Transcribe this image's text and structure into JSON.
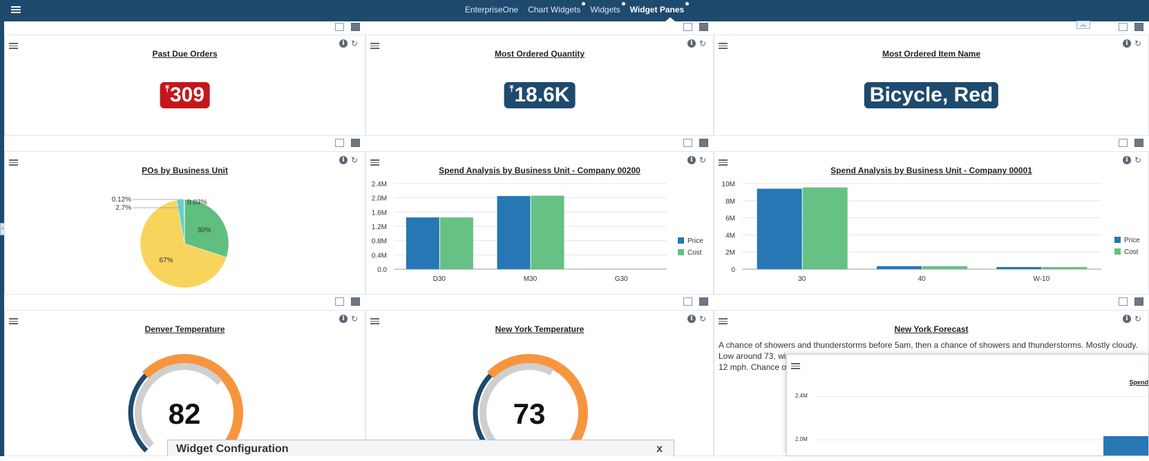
{
  "nav": {
    "items": [
      {
        "label": "EnterpriseOne",
        "active": false,
        "dot": false
      },
      {
        "label": "Chart Widgets",
        "active": false,
        "dot": true
      },
      {
        "label": "Widgets",
        "active": false,
        "dot": true
      },
      {
        "label": "Widget Panes",
        "active": true,
        "dot": true
      }
    ]
  },
  "panes": {
    "past_due": {
      "title": "Past Due Orders",
      "value": "309",
      "arrow": "⤒",
      "color": "#c4161c"
    },
    "most_qty": {
      "title": "Most Ordered Quantity",
      "value": "18.6K",
      "arrow": "⤒",
      "color": "#1e4a6e"
    },
    "most_item": {
      "title": "Most Ordered Item Name",
      "value": "Bicycle, Red",
      "color": "#1e4a6e"
    },
    "pos_bu": {
      "title": "POs by Business Unit"
    },
    "spend_200": {
      "title": "Spend Analysis by Business Unit - Company 00200"
    },
    "spend_001": {
      "title": "Spend Analysis by Business Unit - Company 00001"
    },
    "denver": {
      "title": "Denver Temperature",
      "value": "82"
    },
    "newyork": {
      "title": "New York Temperature",
      "value": "73"
    },
    "forecast": {
      "title": "New York Forecast",
      "line1": "A chance of showers and thunderstorms before 5am, then a chance of showers and thunderstorms. Mostly cloudy.",
      "line2": "Low around 73, wi",
      "line3": "12 mph. Chance o"
    }
  },
  "overlay": {
    "title": "Spend",
    "tick_top": "2.4M",
    "tick_bottom": "2.0M"
  },
  "dialog": {
    "title": "Widget Configuration",
    "close": "x"
  },
  "chart_data": [
    {
      "type": "pie",
      "title": "POs by Business Unit",
      "labels": [
        "30%",
        "67%",
        "2.7%",
        "0.12%",
        "0.03%"
      ],
      "values": [
        30,
        67,
        2.7,
        0.12,
        0.03
      ],
      "colors": [
        "#5fbf7f",
        "#f9d45c",
        "#66d0c8",
        "#2b79b5",
        "#a9d6f5"
      ]
    },
    {
      "type": "bar",
      "title": "Spend Analysis by Business Unit - Company 00200",
      "categories": [
        "D30",
        "M30",
        "G30"
      ],
      "series": [
        {
          "name": "Price",
          "values": [
            1.45,
            2.05,
            0
          ],
          "color": "#2677b4"
        },
        {
          "name": "Cost",
          "values": [
            1.45,
            2.06,
            0
          ],
          "color": "#66c184"
        }
      ],
      "ylim": [
        0,
        2.4
      ],
      "yticks": [
        "0.0",
        "0.4M",
        "0.8M",
        "1.2M",
        "1.6M",
        "2.0M",
        "2.4M"
      ],
      "legend": "right"
    },
    {
      "type": "bar",
      "title": "Spend Analysis by Business Unit - Company 00001",
      "categories": [
        "30",
        "40",
        "W-10"
      ],
      "series": [
        {
          "name": "Price",
          "values": [
            9.4,
            0.35,
            0.25
          ],
          "color": "#2677b4"
        },
        {
          "name": "Cost",
          "values": [
            9.55,
            0.35,
            0.25
          ],
          "color": "#66c184"
        }
      ],
      "ylim": [
        0,
        10
      ],
      "yticks": [
        "0",
        "2M",
        "4M",
        "6M",
        "8M",
        "10M"
      ],
      "legend": "right"
    },
    {
      "type": "gauge",
      "title": "Denver Temperature",
      "value": 82,
      "min": 0,
      "max": 120
    },
    {
      "type": "gauge",
      "title": "New York Temperature",
      "value": 73,
      "min": 0,
      "max": 120
    }
  ]
}
